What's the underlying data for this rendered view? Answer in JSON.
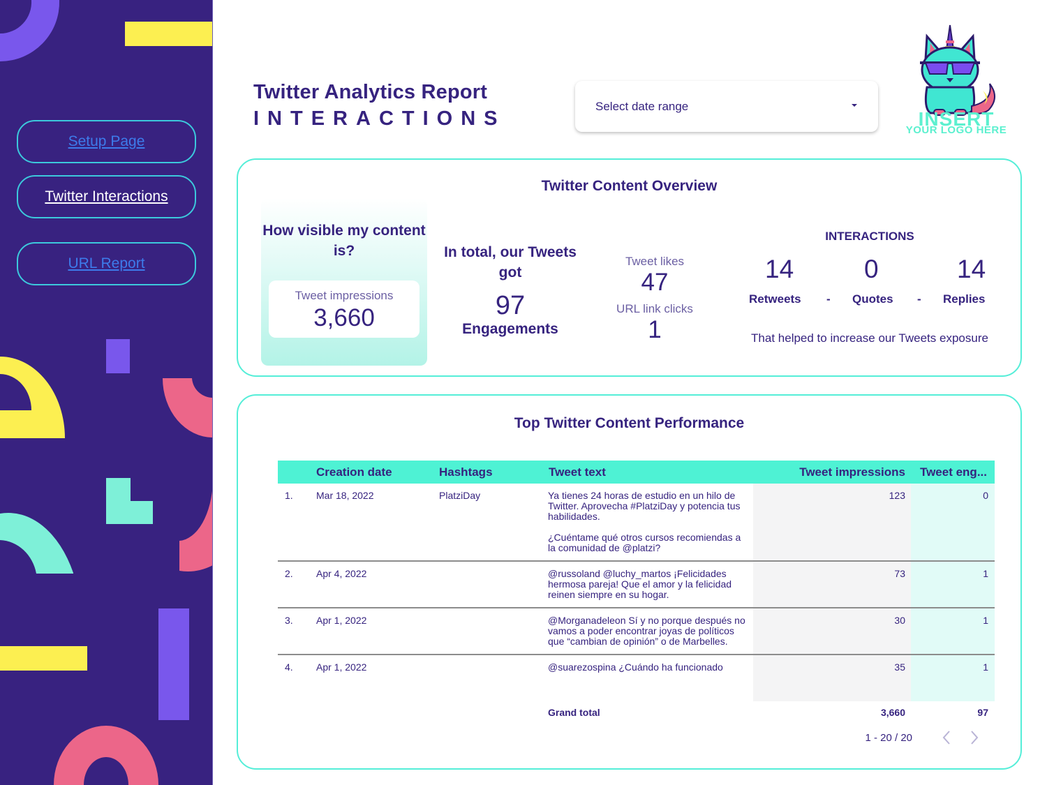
{
  "sidebar": {
    "nav": [
      {
        "label": "Setup Page",
        "state": "link"
      },
      {
        "label": "Twitter Interactions",
        "state": "active"
      },
      {
        "label": "URL Report",
        "state": "link"
      }
    ],
    "colors": {
      "background": "#382280",
      "yellow": "#fcef51",
      "purple": "#7957ec",
      "pink": "#ec6689",
      "mint": "#7ef0d8",
      "border": "#3cc9dc"
    }
  },
  "header": {
    "title": "Twitter Analytics Report",
    "subtitle": "INTERACTIONS",
    "date_select": {
      "placeholder": "Select date range",
      "icon": "caret-down-icon"
    },
    "logo": {
      "line1": "INSERT",
      "line2": "YOUR LOGO HERE",
      "icon": "unicorn-cat-logo"
    }
  },
  "overview": {
    "title": "Twitter Content Overview",
    "visibility": {
      "question": "How visible my content is?",
      "label": "Tweet impressions",
      "value": "3,660"
    },
    "engagement": {
      "lead": "In total, our Tweets got",
      "value": "97",
      "label": "Engagements"
    },
    "likes": {
      "label": "Tweet likes",
      "value": "47"
    },
    "clicks": {
      "label": "URL link clicks",
      "value": "1"
    },
    "interactions": {
      "heading": "INTERACTIONS",
      "retweets": {
        "value": "14",
        "label": "Retweets"
      },
      "quotes": {
        "value": "0",
        "label": "Quotes"
      },
      "replies": {
        "value": "14",
        "label": "Replies"
      },
      "separator": "-",
      "footer": "That helped to increase our Tweets exposure"
    }
  },
  "performance": {
    "title": "Top Twitter Content Performance",
    "columns": [
      "Creation date",
      "Hashtags",
      "Tweet text",
      "Tweet impressions",
      "Tweet eng..."
    ],
    "rows": [
      {
        "index": "1.",
        "date": "Mar 18, 2022",
        "hashtags": "PlatziDay",
        "text": "Ya tienes 24 horas de estudio en un hilo de Twitter. Aprovecha #PlatziDay y potencia tus habilidades.\n\n¿Cuéntame qué otros cursos recomiendas a la comunidad de @platzi?",
        "impressions": "123",
        "engagements": "0"
      },
      {
        "index": "2.",
        "date": "Apr 4, 2022",
        "hashtags": "",
        "text": "@russoland @luchy_martos ¡Felicidades hermosa pareja! Que el amor y la felicidad reinen siempre en su hogar.",
        "impressions": "73",
        "engagements": "1"
      },
      {
        "index": "3.",
        "date": "Apr 1, 2022",
        "hashtags": "",
        "text": "@Morganadeleon Sí y no porque después no vamos a poder encontrar joyas de políticos que “cambian de opinión” o de Marbelles.",
        "impressions": "30",
        "engagements": "1"
      },
      {
        "index": "4.",
        "date": "Apr 1, 2022",
        "hashtags": "",
        "text": "@suarezospina ¿Cuándo ha funcionado",
        "impressions": "35",
        "engagements": "1"
      }
    ],
    "grand_total": {
      "label": "Grand total",
      "impressions": "3,660",
      "engagements": "97"
    },
    "pagination": {
      "range": "1 - 20 / 20",
      "prev_icon": "chevron-left-icon",
      "next_icon": "chevron-right-icon"
    }
  }
}
